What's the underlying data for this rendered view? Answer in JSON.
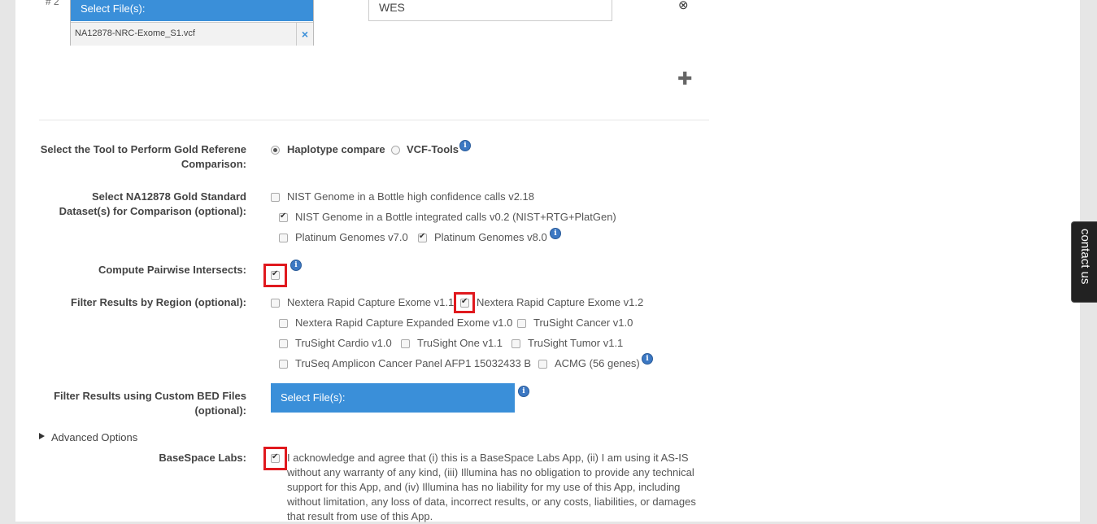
{
  "sample2": {
    "row_label": "# 2",
    "select_files_label": "Select File(s):",
    "file_name": "NA12878-NRC-Exome_S1.vcf",
    "remove_symbol": "×",
    "input_value": "WES",
    "close_symbol": "⊗",
    "add_symbol": "✚"
  },
  "tool": {
    "label": "Select the Tool to Perform Gold Referene Comparison:",
    "options": [
      {
        "label": "Haplotype compare",
        "selected": true
      },
      {
        "label": "VCF-Tools",
        "selected": false
      }
    ]
  },
  "gold_standard": {
    "label": "Select NA12878 Gold Standard Dataset(s) for Comparison (optional):",
    "options": [
      {
        "label": "NIST Genome in a Bottle high confidence calls v2.18",
        "checked": false
      },
      {
        "label": "NIST Genome in a Bottle integrated calls v0.2 (NIST+RTG+PlatGen)",
        "checked": true
      },
      {
        "label": "Platinum Genomes v7.0",
        "checked": false
      },
      {
        "label": "Platinum Genomes v8.0",
        "checked": true
      }
    ]
  },
  "pairwise": {
    "label": "Compute Pairwise Intersects:",
    "checked": true
  },
  "filter_region": {
    "label": "Filter Results by Region (optional):",
    "options": [
      {
        "label": "Nextera Rapid Capture Exome v1.1",
        "checked": false
      },
      {
        "label": "Nextera Rapid Capture Exome v1.2",
        "checked": true
      },
      {
        "label": "Nextera Rapid Capture Expanded Exome v1.0",
        "checked": false
      },
      {
        "label": "TruSight Cancer v1.0",
        "checked": false
      },
      {
        "label": "TruSight Cardio v1.0",
        "checked": false
      },
      {
        "label": "TruSight One v1.1",
        "checked": false
      },
      {
        "label": "TruSight Tumor v1.1",
        "checked": false
      },
      {
        "label": "TruSeq Amplicon Cancer Panel AFP1 15032433 B",
        "checked": false
      },
      {
        "label": "ACMG (56 genes)",
        "checked": false
      }
    ]
  },
  "custom_bed": {
    "label": "Filter Results using Custom BED Files (optional):",
    "button_label": "Select File(s):"
  },
  "advanced": {
    "label": "Advanced Options"
  },
  "basespace": {
    "label": "BaseSpace Labs:",
    "checked": true,
    "text": "I acknowledge and agree that (i) this is a BaseSpace Labs App, (ii) I am using it AS-IS without any warranty of any kind, (iii) Illumina has no obligation to provide any technical support for this App, and (iv) Illumina has no liability for my use of this App, including without limitation, any loss of data, incorrect results, or any costs, liabilities, or damages that result from use of this App."
  },
  "contact": {
    "label": "contact us"
  },
  "icons": {
    "info": "i"
  },
  "colors": {
    "accent": "#3a8fd9",
    "highlight": "#e0191e",
    "info": "#3c78c3"
  }
}
